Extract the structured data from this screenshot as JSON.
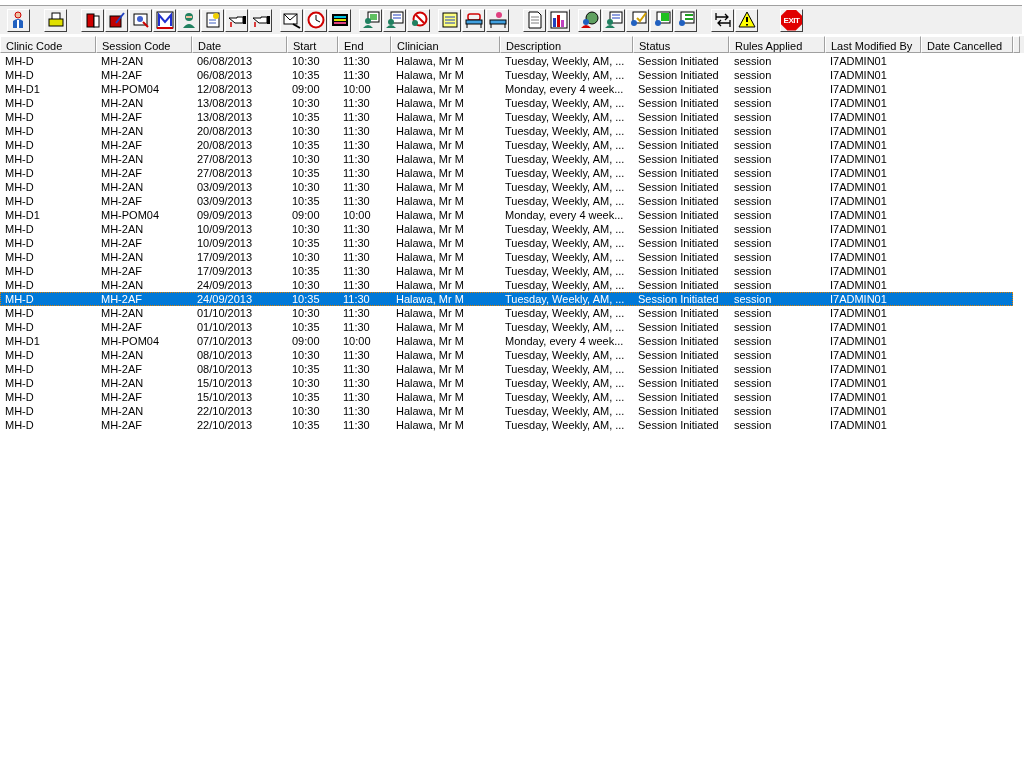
{
  "toolbar": {
    "exit_label": "EXIT"
  },
  "table": {
    "columns": [
      "Clinic Code",
      "Session Code",
      "Date",
      "Start",
      "End",
      "Clinician",
      "Description",
      "Status",
      "Rules Applied",
      "Last Modified By",
      "Date Cancelled"
    ],
    "rows": [
      {
        "selected": false,
        "cells": [
          "MH-D",
          "MH-2AN",
          "06/08/2013",
          "10:30",
          "11:30",
          "Halawa, Mr M",
          "Tuesday, Weekly, AM, ...",
          "Session Initiated",
          "session",
          "I7ADMIN01"
        ]
      },
      {
        "selected": false,
        "cells": [
          "MH-D",
          "MH-2AF",
          "06/08/2013",
          "10:35",
          "11:30",
          "Halawa, Mr M",
          "Tuesday, Weekly, AM, ...",
          "Session Initiated",
          "session",
          "I7ADMIN01"
        ]
      },
      {
        "selected": false,
        "cells": [
          "MH-D1",
          "MH-POM04",
          "12/08/2013",
          "09:00",
          "10:00",
          "Halawa, Mr M",
          "Monday, every 4 week...",
          "Session Initiated",
          "session",
          "I7ADMIN01"
        ]
      },
      {
        "selected": false,
        "cells": [
          "MH-D",
          "MH-2AN",
          "13/08/2013",
          "10:30",
          "11:30",
          "Halawa, Mr M",
          "Tuesday, Weekly, AM, ...",
          "Session Initiated",
          "session",
          "I7ADMIN01"
        ]
      },
      {
        "selected": false,
        "cells": [
          "MH-D",
          "MH-2AF",
          "13/08/2013",
          "10:35",
          "11:30",
          "Halawa, Mr M",
          "Tuesday, Weekly, AM, ...",
          "Session Initiated",
          "session",
          "I7ADMIN01"
        ]
      },
      {
        "selected": false,
        "cells": [
          "MH-D",
          "MH-2AN",
          "20/08/2013",
          "10:30",
          "11:30",
          "Halawa, Mr M",
          "Tuesday, Weekly, AM, ...",
          "Session Initiated",
          "session",
          "I7ADMIN01"
        ]
      },
      {
        "selected": false,
        "cells": [
          "MH-D",
          "MH-2AF",
          "20/08/2013",
          "10:35",
          "11:30",
          "Halawa, Mr M",
          "Tuesday, Weekly, AM, ...",
          "Session Initiated",
          "session",
          "I7ADMIN01"
        ]
      },
      {
        "selected": false,
        "cells": [
          "MH-D",
          "MH-2AN",
          "27/08/2013",
          "10:30",
          "11:30",
          "Halawa, Mr M",
          "Tuesday, Weekly, AM, ...",
          "Session Initiated",
          "session",
          "I7ADMIN01"
        ]
      },
      {
        "selected": false,
        "cells": [
          "MH-D",
          "MH-2AF",
          "27/08/2013",
          "10:35",
          "11:30",
          "Halawa, Mr M",
          "Tuesday, Weekly, AM, ...",
          "Session Initiated",
          "session",
          "I7ADMIN01"
        ]
      },
      {
        "selected": false,
        "cells": [
          "MH-D",
          "MH-2AN",
          "03/09/2013",
          "10:30",
          "11:30",
          "Halawa, Mr M",
          "Tuesday, Weekly, AM, ...",
          "Session Initiated",
          "session",
          "I7ADMIN01"
        ]
      },
      {
        "selected": false,
        "cells": [
          "MH-D",
          "MH-2AF",
          "03/09/2013",
          "10:35",
          "11:30",
          "Halawa, Mr M",
          "Tuesday, Weekly, AM, ...",
          "Session Initiated",
          "session",
          "I7ADMIN01"
        ]
      },
      {
        "selected": false,
        "cells": [
          "MH-D1",
          "MH-POM04",
          "09/09/2013",
          "09:00",
          "10:00",
          "Halawa, Mr M",
          "Monday, every 4 week...",
          "Session Initiated",
          "session",
          "I7ADMIN01"
        ]
      },
      {
        "selected": false,
        "cells": [
          "MH-D",
          "MH-2AN",
          "10/09/2013",
          "10:30",
          "11:30",
          "Halawa, Mr M",
          "Tuesday, Weekly, AM, ...",
          "Session Initiated",
          "session",
          "I7ADMIN01"
        ]
      },
      {
        "selected": false,
        "cells": [
          "MH-D",
          "MH-2AF",
          "10/09/2013",
          "10:35",
          "11:30",
          "Halawa, Mr M",
          "Tuesday, Weekly, AM, ...",
          "Session Initiated",
          "session",
          "I7ADMIN01"
        ]
      },
      {
        "selected": false,
        "cells": [
          "MH-D",
          "MH-2AN",
          "17/09/2013",
          "10:30",
          "11:30",
          "Halawa, Mr M",
          "Tuesday, Weekly, AM, ...",
          "Session Initiated",
          "session",
          "I7ADMIN01"
        ]
      },
      {
        "selected": false,
        "cells": [
          "MH-D",
          "MH-2AF",
          "17/09/2013",
          "10:35",
          "11:30",
          "Halawa, Mr M",
          "Tuesday, Weekly, AM, ...",
          "Session Initiated",
          "session",
          "I7ADMIN01"
        ]
      },
      {
        "selected": false,
        "cells": [
          "MH-D",
          "MH-2AN",
          "24/09/2013",
          "10:30",
          "11:30",
          "Halawa, Mr M",
          "Tuesday, Weekly, AM, ...",
          "Session Initiated",
          "session",
          "I7ADMIN01"
        ]
      },
      {
        "selected": true,
        "cells": [
          "MH-D",
          "MH-2AF",
          "24/09/2013",
          "10:35",
          "11:30",
          "Halawa, Mr M",
          "Tuesday, Weekly, AM, ...",
          "Session Initiated",
          "session",
          "I7ADMIN01"
        ]
      },
      {
        "selected": false,
        "cells": [
          "MH-D",
          "MH-2AN",
          "01/10/2013",
          "10:30",
          "11:30",
          "Halawa, Mr M",
          "Tuesday, Weekly, AM, ...",
          "Session Initiated",
          "session",
          "I7ADMIN01"
        ]
      },
      {
        "selected": false,
        "cells": [
          "MH-D",
          "MH-2AF",
          "01/10/2013",
          "10:35",
          "11:30",
          "Halawa, Mr M",
          "Tuesday, Weekly, AM, ...",
          "Session Initiated",
          "session",
          "I7ADMIN01"
        ]
      },
      {
        "selected": false,
        "cells": [
          "MH-D1",
          "MH-POM04",
          "07/10/2013",
          "09:00",
          "10:00",
          "Halawa, Mr M",
          "Monday, every 4 week...",
          "Session Initiated",
          "session",
          "I7ADMIN01"
        ]
      },
      {
        "selected": false,
        "cells": [
          "MH-D",
          "MH-2AN",
          "08/10/2013",
          "10:30",
          "11:30",
          "Halawa, Mr M",
          "Tuesday, Weekly, AM, ...",
          "Session Initiated",
          "session",
          "I7ADMIN01"
        ]
      },
      {
        "selected": false,
        "cells": [
          "MH-D",
          "MH-2AF",
          "08/10/2013",
          "10:35",
          "11:30",
          "Halawa, Mr M",
          "Tuesday, Weekly, AM, ...",
          "Session Initiated",
          "session",
          "I7ADMIN01"
        ]
      },
      {
        "selected": false,
        "cells": [
          "MH-D",
          "MH-2AN",
          "15/10/2013",
          "10:30",
          "11:30",
          "Halawa, Mr M",
          "Tuesday, Weekly, AM, ...",
          "Session Initiated",
          "session",
          "I7ADMIN01"
        ]
      },
      {
        "selected": false,
        "cells": [
          "MH-D",
          "MH-2AF",
          "15/10/2013",
          "10:35",
          "11:30",
          "Halawa, Mr M",
          "Tuesday, Weekly, AM, ...",
          "Session Initiated",
          "session",
          "I7ADMIN01"
        ]
      },
      {
        "selected": false,
        "cells": [
          "MH-D",
          "MH-2AN",
          "22/10/2013",
          "10:30",
          "11:30",
          "Halawa, Mr M",
          "Tuesday, Weekly, AM, ...",
          "Session Initiated",
          "session",
          "I7ADMIN01"
        ]
      },
      {
        "selected": false,
        "cells": [
          "MH-D",
          "MH-2AF",
          "22/10/2013",
          "10:35",
          "11:30",
          "Halawa, Mr M",
          "Tuesday, Weekly, AM, ...",
          "Session Initiated",
          "session",
          "I7ADMIN01"
        ]
      }
    ]
  }
}
